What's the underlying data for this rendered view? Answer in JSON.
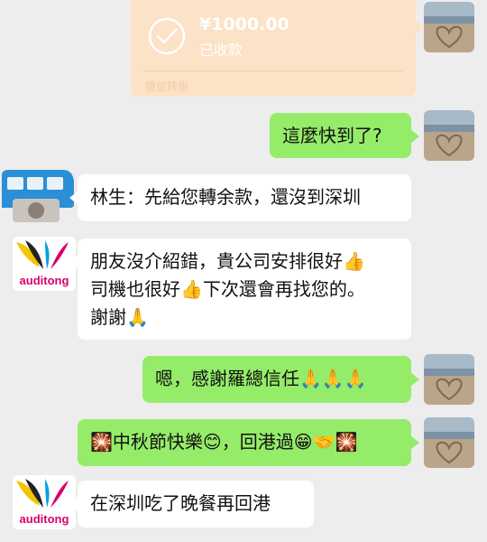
{
  "transfer": {
    "amount": "¥1000.00",
    "status": "已收款",
    "footer": "微信转账"
  },
  "messages": [
    {
      "side": "right",
      "text": "這麼快到了?"
    },
    {
      "side": "left",
      "text": "林生：先給您轉余款，還沒到深圳"
    },
    {
      "side": "left",
      "lines": [
        "朋友沒介紹錯，貴公司安排很好👍",
        "司機也很好👍下次還會再找您的。",
        "謝謝🙏"
      ]
    },
    {
      "side": "right",
      "text": "嗯，感謝羅總信任🙏🙏🙏"
    },
    {
      "side": "right",
      "text": "🎇中秋節快樂😊，回港過😁🤝🎇"
    },
    {
      "side": "left",
      "text": "在深圳吃了晚餐再回港"
    }
  ],
  "logo": {
    "text": "auditong"
  },
  "colors": {
    "background": "#ededed",
    "green_bubble": "#95ec69",
    "white_bubble": "#ffffff",
    "transfer_card": "#fce2c6"
  }
}
